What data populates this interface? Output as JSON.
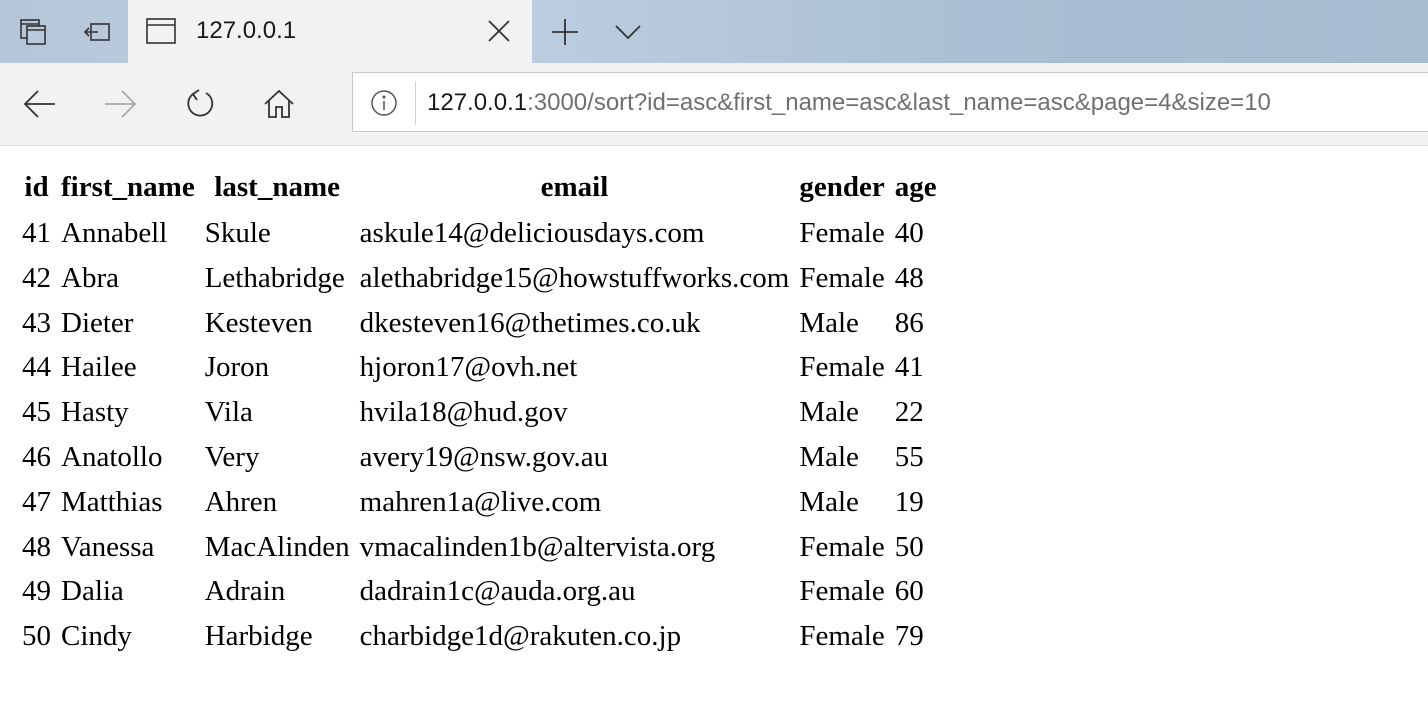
{
  "browser": {
    "tab": {
      "title": "127.0.0.1"
    },
    "address": {
      "host": "127.0.0.1",
      "rest": ":3000/sort?id=asc&first_name=asc&last_name=asc&page=4&size=10"
    }
  },
  "table": {
    "headers": [
      "id",
      "first_name",
      "last_name",
      "email",
      "gender",
      "age"
    ],
    "rows": [
      [
        "41",
        "Annabell",
        "Skule",
        "askule14@deliciousdays.com",
        "Female",
        "40"
      ],
      [
        "42",
        "Abra",
        "Lethabridge",
        "alethabridge15@howstuffworks.com",
        "Female",
        "48"
      ],
      [
        "43",
        "Dieter",
        "Kesteven",
        "dkesteven16@thetimes.co.uk",
        "Male",
        "86"
      ],
      [
        "44",
        "Hailee",
        "Joron",
        "hjoron17@ovh.net",
        "Female",
        "41"
      ],
      [
        "45",
        "Hasty",
        "Vila",
        "hvila18@hud.gov",
        "Male",
        "22"
      ],
      [
        "46",
        "Anatollo",
        "Very",
        "avery19@nsw.gov.au",
        "Male",
        "55"
      ],
      [
        "47",
        "Matthias",
        "Ahren",
        "mahren1a@live.com",
        "Male",
        "19"
      ],
      [
        "48",
        "Vanessa",
        "MacAlinden",
        "vmacalinden1b@altervista.org",
        "Female",
        "50"
      ],
      [
        "49",
        "Dalia",
        "Adrain",
        "dadrain1c@auda.org.au",
        "Female",
        "60"
      ],
      [
        "50",
        "Cindy",
        "Harbidge",
        "charbidge1d@rakuten.co.jp",
        "Female",
        "79"
      ]
    ]
  }
}
